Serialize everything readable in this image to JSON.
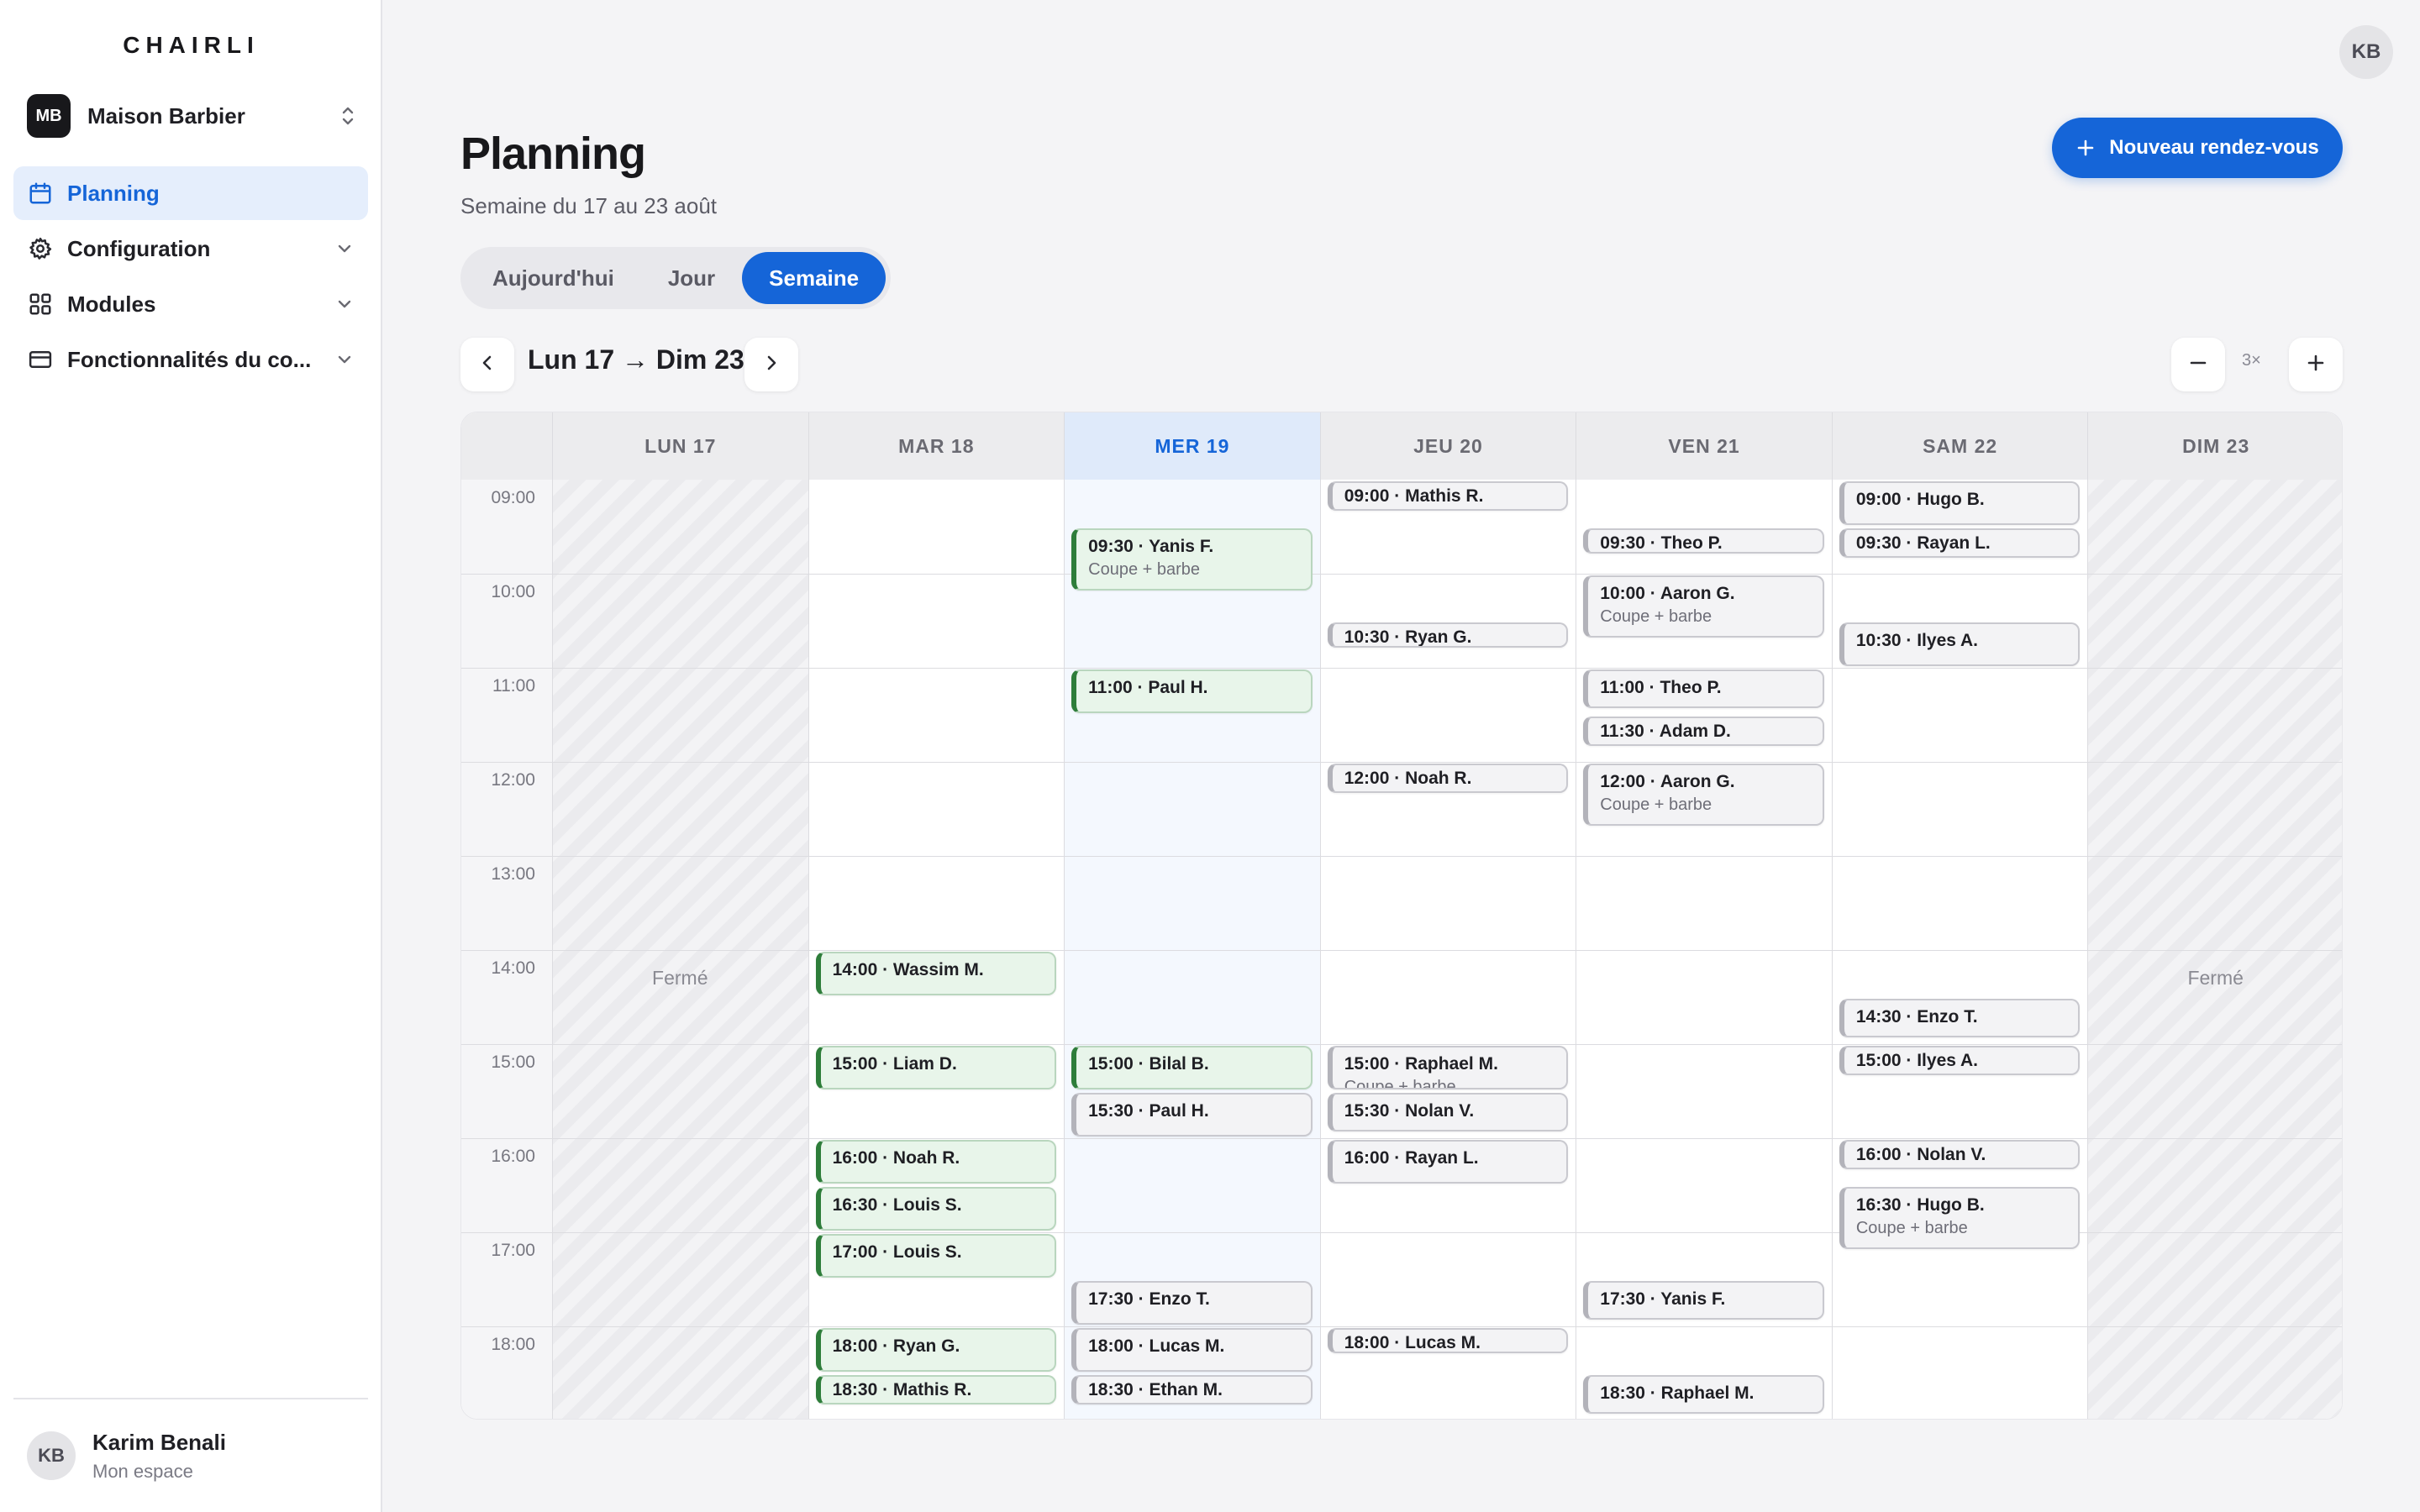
{
  "brand": "CHAIRLI",
  "org": {
    "initials": "MB",
    "name": "Maison Barbier"
  },
  "nav": [
    {
      "label": "Planning",
      "icon": "calendar-icon",
      "active": true
    },
    {
      "label": "Configuration",
      "icon": "gear-icon"
    },
    {
      "label": "Modules",
      "icon": "grid-icon"
    },
    {
      "label": "Fonctionnalités du co...",
      "icon": "card-icon"
    }
  ],
  "user": {
    "initials": "KB",
    "name": "Karim Benali",
    "subtitle": "Mon espace"
  },
  "header": {
    "title": "Planning",
    "subtitle": "Semaine du 17 au 23 août",
    "new_button": "Nouveau rendez-vous",
    "avatar": "KB"
  },
  "view_tabs": [
    {
      "label": "Aujourd'hui",
      "active": false
    },
    {
      "label": "Jour",
      "active": false
    },
    {
      "label": "Semaine",
      "active": true
    }
  ],
  "range_label": "Lun 17 → Dim 23",
  "zoom_label": "3×",
  "calendar": {
    "hours": [
      "09:00",
      "10:00",
      "11:00",
      "12:00",
      "13:00",
      "14:00",
      "15:00",
      "16:00",
      "17:00",
      "18:00"
    ],
    "closed_label": "Fermé",
    "today_color": "#1565d8",
    "days": [
      {
        "label": "LUN 17",
        "closed": true
      },
      {
        "label": "MAR 18"
      },
      {
        "label": "MER 19",
        "today": true
      },
      {
        "label": "JEU 20"
      },
      {
        "label": "VEN 21"
      },
      {
        "label": "SAM 22"
      },
      {
        "label": "DIM 23",
        "closed": true
      }
    ],
    "appointments": [
      {
        "day": 1,
        "start": 14.0,
        "end": 14.5,
        "label": "14:00 · Wassim M.",
        "status": "green"
      },
      {
        "day": 1,
        "start": 15.0,
        "end": 15.5,
        "label": "15:00 · Liam D.",
        "status": "green"
      },
      {
        "day": 1,
        "start": 16.0,
        "end": 16.5,
        "label": "16:00 · Noah R.",
        "status": "green"
      },
      {
        "day": 1,
        "start": 16.5,
        "end": 17.0,
        "label": "16:30 · Louis S.",
        "status": "green"
      },
      {
        "day": 1,
        "start": 17.0,
        "end": 17.5,
        "label": "17:00 · Louis S.",
        "status": "green"
      },
      {
        "day": 1,
        "start": 18.0,
        "end": 18.5,
        "label": "18:00 · Ryan G.",
        "status": "green"
      },
      {
        "day": 1,
        "start": 18.5,
        "end": 18.85,
        "label": "18:30 · Mathis R.",
        "status": "green"
      },
      {
        "day": 2,
        "start": 9.5,
        "end": 10.2,
        "label": "09:30 · Yanis F.",
        "service": "Coupe + barbe",
        "status": "green"
      },
      {
        "day": 2,
        "start": 11.0,
        "end": 11.5,
        "label": "11:00 · Paul H.",
        "status": "green"
      },
      {
        "day": 2,
        "start": 15.0,
        "end": 15.5,
        "label": "15:00 · Bilal B.",
        "status": "green"
      },
      {
        "day": 2,
        "start": 15.5,
        "end": 16.0,
        "label": "15:30 · Paul H.",
        "status": "gray"
      },
      {
        "day": 2,
        "start": 17.5,
        "end": 18.0,
        "label": "17:30 · Enzo T.",
        "status": "gray"
      },
      {
        "day": 2,
        "start": 18.0,
        "end": 18.5,
        "label": "18:00 · Lucas M.",
        "status": "gray"
      },
      {
        "day": 2,
        "start": 18.5,
        "end": 18.85,
        "label": "18:30 · Ethan M.",
        "status": "gray"
      },
      {
        "day": 3,
        "start": 9.0,
        "end": 9.35,
        "label": "09:00 · Mathis R.",
        "status": "gray"
      },
      {
        "day": 3,
        "start": 10.5,
        "end": 10.75,
        "label": "10:30 · Ryan G.",
        "status": "gray"
      },
      {
        "day": 3,
        "start": 12.0,
        "end": 12.35,
        "label": "12:00 · Noah R.",
        "status": "gray"
      },
      {
        "day": 3,
        "start": 15.0,
        "end": 15.5,
        "label": "15:00 · Raphael M.",
        "service": "Coupe + barbe",
        "status": "gray"
      },
      {
        "day": 3,
        "start": 15.5,
        "end": 15.95,
        "label": "15:30 · Nolan V.",
        "status": "gray"
      },
      {
        "day": 3,
        "start": 16.0,
        "end": 16.5,
        "label": "16:00 · Rayan L.",
        "status": "gray"
      },
      {
        "day": 3,
        "start": 18.0,
        "end": 18.25,
        "label": "18:00 · Lucas M.",
        "status": "gray"
      },
      {
        "day": 4,
        "start": 9.5,
        "end": 9.75,
        "label": "09:30 · Theo P.",
        "status": "gray"
      },
      {
        "day": 4,
        "start": 10.0,
        "end": 10.7,
        "label": "10:00 · Aaron G.",
        "service": "Coupe + barbe",
        "status": "gray"
      },
      {
        "day": 4,
        "start": 11.0,
        "end": 11.45,
        "label": "11:00 · Theo P.",
        "status": "gray"
      },
      {
        "day": 4,
        "start": 11.5,
        "end": 11.85,
        "label": "11:30 · Adam D.",
        "status": "gray"
      },
      {
        "day": 4,
        "start": 12.0,
        "end": 12.7,
        "label": "12:00 · Aaron G.",
        "service": "Coupe + barbe",
        "status": "gray"
      },
      {
        "day": 4,
        "start": 17.5,
        "end": 17.95,
        "label": "17:30 · Yanis F.",
        "status": "gray"
      },
      {
        "day": 4,
        "start": 18.5,
        "end": 18.95,
        "label": "18:30 · Raphael M.",
        "status": "gray"
      },
      {
        "day": 5,
        "start": 9.0,
        "end": 9.5,
        "label": "09:00 · Hugo B.",
        "status": "gray"
      },
      {
        "day": 5,
        "start": 9.5,
        "end": 9.85,
        "label": "09:30 · Rayan L.",
        "status": "gray"
      },
      {
        "day": 5,
        "start": 10.5,
        "end": 11.0,
        "label": "10:30 · Ilyes A.",
        "status": "gray"
      },
      {
        "day": 5,
        "start": 14.5,
        "end": 14.95,
        "label": "14:30 · Enzo T.",
        "status": "gray"
      },
      {
        "day": 5,
        "start": 15.0,
        "end": 15.35,
        "label": "15:00 · Ilyes A.",
        "status": "gray"
      },
      {
        "day": 5,
        "start": 16.0,
        "end": 16.35,
        "label": "16:00 · Nolan V.",
        "status": "gray"
      },
      {
        "day": 5,
        "start": 16.5,
        "end": 17.2,
        "label": "16:30 · Hugo B.",
        "service": "Coupe + barbe",
        "status": "gray"
      }
    ]
  }
}
